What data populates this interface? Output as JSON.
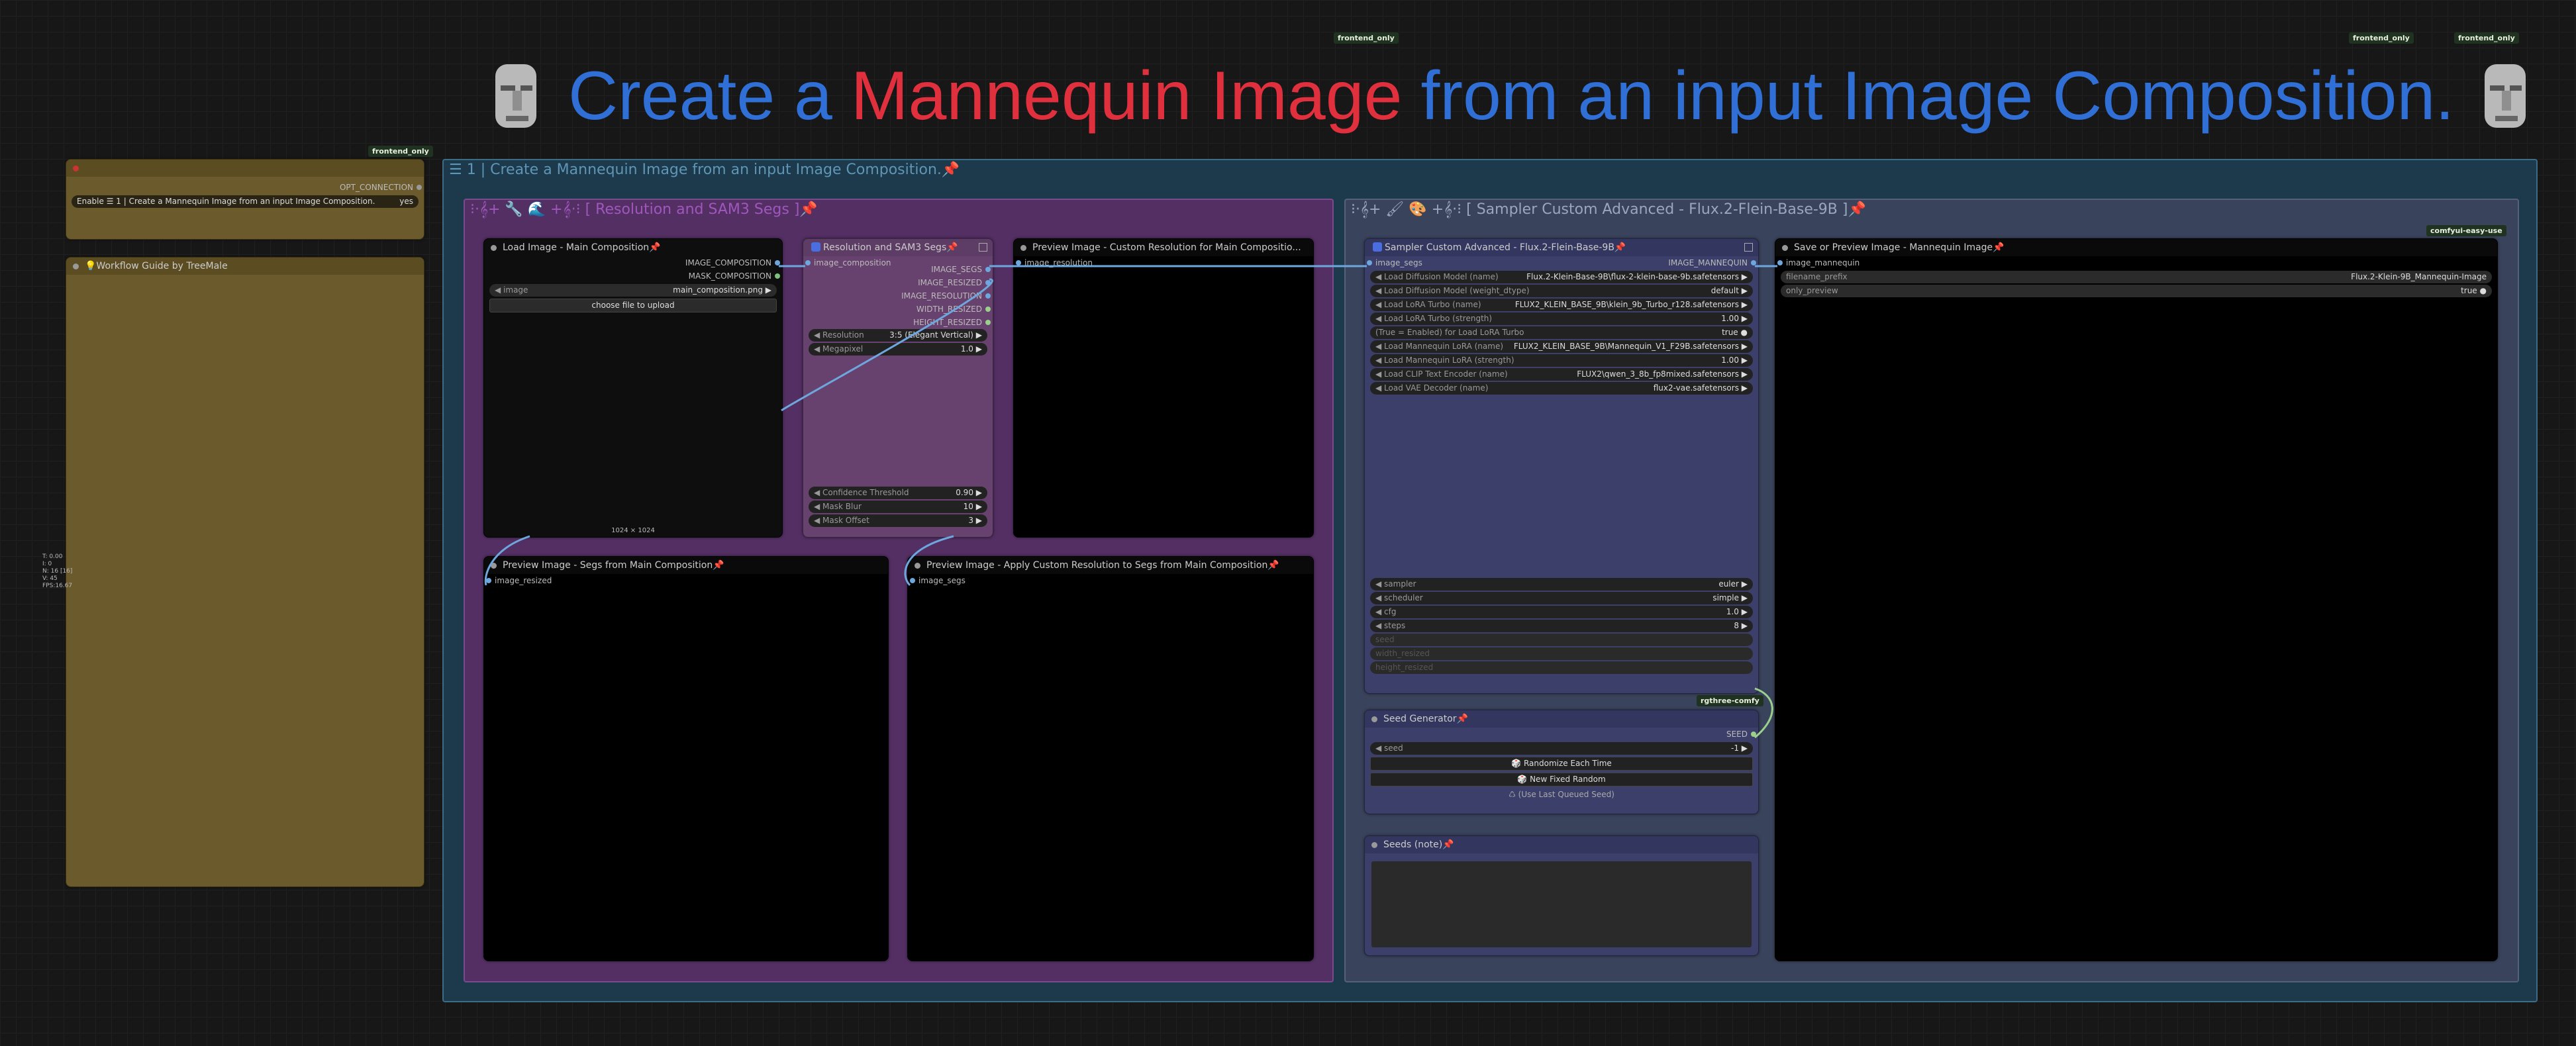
{
  "tags": {
    "frontend_only": "frontend_only",
    "comfyui_easy_use": "comfyui-easy-use",
    "rgthree_comfy": "rgthree-comfy"
  },
  "title": {
    "part1": "Create a",
    "part2": "Mannequin Image",
    "part3": "from an input Image Composition.",
    "colors": {
      "blue": "#2f6fd6",
      "red": "#e0303e"
    },
    "icon": "moai-icon"
  },
  "fast_groups": {
    "header": "OPT_CONNECTION",
    "toggle_label": "Enable ☰ 1 | Create a Mannequin Image from an input Image Composition.",
    "toggle_value": "yes"
  },
  "guide": {
    "title": "💡Workflow Guide by TreeMale"
  },
  "group_main": {
    "title": "☰ 1 | Create a Mannequin Image from an input Image Composition.📌"
  },
  "group_res": {
    "title": "⁝·𝄞+ 🔧 🌊 +𝄞·⁝ [ Resolution and SAM3 Segs ]📌"
  },
  "group_sampler": {
    "title": "⁝·𝄞+ 🖌 🎨 +𝄞·⁝ [ Sampler Custom Advanced - Flux.2-Flein-Base-9B ]📌"
  },
  "load_image": {
    "title": "Load Image - Main Composition📌",
    "outputs": [
      "IMAGE_COMPOSITION",
      "MASK_COMPOSITION"
    ],
    "image_label": "image",
    "image_value": "main_composition.png",
    "upload": "choose file to upload",
    "size": "1024 × 1024"
  },
  "res_sam": {
    "title": "Resolution and SAM3 Segs📌",
    "input": "image_composition",
    "outputs": [
      "IMAGE_SEGS",
      "IMAGE_RESIZED",
      "IMAGE_RESOLUTION",
      "WIDTH_RESIZED",
      "HEIGHT_RESIZED"
    ],
    "widgets_top": [
      {
        "label": "Resolution",
        "value": "3:5 (Elegant Vertical)"
      },
      {
        "label": "Megapixel",
        "value": "1.0"
      }
    ],
    "widgets_bottom": [
      {
        "label": "Confidence Threshold",
        "value": "0.90"
      },
      {
        "label": "Mask Blur",
        "value": "10"
      },
      {
        "label": "Mask Offset",
        "value": "3"
      }
    ]
  },
  "preview_res": {
    "title": "Preview Image - Custom Resolution for Main Compositio...",
    "input": "image_resolution"
  },
  "preview_segs": {
    "title": "Preview Image - Segs from Main Composition📌",
    "input": "image_resized"
  },
  "preview_apply": {
    "title": "Preview Image - Apply Custom Resolution to Segs from Main Composition📌",
    "input": "image_segs"
  },
  "sampler": {
    "title": "Sampler Custom Advanced - Flux.2-Flein-Base-9B📌",
    "input": "image_segs",
    "output": "IMAGE_MANNEQUIN",
    "widgets": [
      {
        "label": "Load Diffusion Model (name)",
        "value": "Flux.2-Klein-Base-9B\\flux-2-klein-base-9b.safetensors"
      },
      {
        "label": "Load Diffusion Model (weight_dtype)",
        "value": "default"
      },
      {
        "label": "Load LoRA Turbo (name)",
        "value": "FLUX2_KLEIN_BASE_9B\\klein_9b_Turbo_r128.safetensors"
      },
      {
        "label": "Load LoRA Turbo (strength)",
        "value": "1.00"
      },
      {
        "label": "(True = Enabled) for Load LoRA Turbo",
        "value": "true"
      },
      {
        "label": "Load Mannequin LoRA (name)",
        "value": "FLUX2_KLEIN_BASE_9B\\Mannequin_V1_F29B.safetensors"
      },
      {
        "label": "Load Mannequin LoRA (strength)",
        "value": "1.00"
      },
      {
        "label": "Load CLIP Text Encoder (name)",
        "value": "FLUX2\\qwen_3_8b_fp8mixed.safetensors"
      },
      {
        "label": "Load VAE Decoder (name)",
        "value": "flux2-vae.safetensors"
      }
    ],
    "widgets_bottom": [
      {
        "label": "sampler",
        "value": "euler"
      },
      {
        "label": "scheduler",
        "value": "simple"
      },
      {
        "label": "cfg",
        "value": "1.0"
      },
      {
        "label": "steps",
        "value": "8"
      }
    ],
    "disabled": [
      "seed",
      "width_resized",
      "height_resized"
    ]
  },
  "seed_gen": {
    "title": "Seed Generator📌",
    "output": "SEED",
    "seed_label": "seed",
    "seed_value": "-1",
    "buttons": [
      "🎲 Randomize Each Time",
      "🎲 New Fixed Random",
      "♺ (Use Last Queued Seed)"
    ]
  },
  "seeds_note": {
    "title": "Seeds (note)📌"
  },
  "save": {
    "title": "Save or Preview Image - Mannequin Image📌",
    "input": "image_mannequin",
    "widgets": [
      {
        "label": "filename_prefix",
        "value": "Flux.2-Klein-9B_Mannequin-Image"
      },
      {
        "label": "only_preview",
        "value": "true"
      }
    ]
  },
  "debug": [
    "T: 0.00",
    "I: 0",
    "N: 16 [16]",
    "V: 45",
    "FPS:16.67"
  ]
}
